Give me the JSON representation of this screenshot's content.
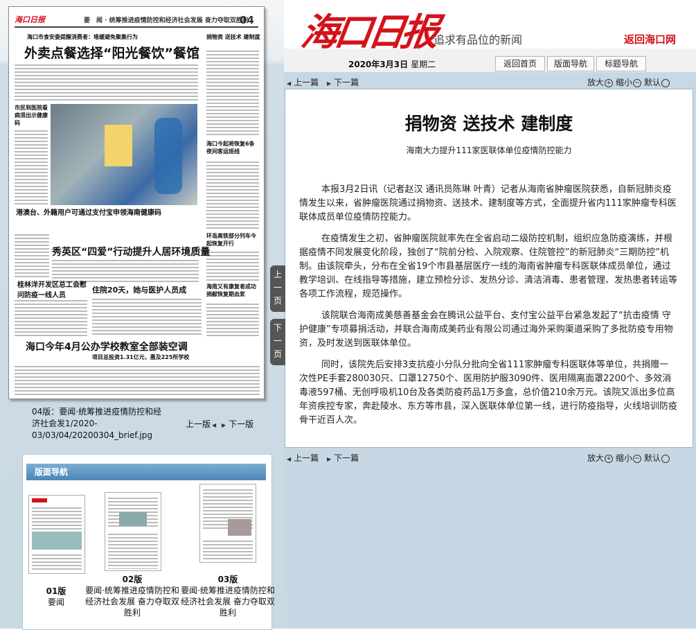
{
  "header": {
    "logo": "海口日报",
    "slogan": "追求有品位的新闻",
    "back_link": "返回海口网",
    "date": "2020年3月3日",
    "weekday": "星期二",
    "nav": [
      "返回首页",
      "版面导航",
      "标题导航"
    ]
  },
  "pager": {
    "prev": "上一篇",
    "next": "下一篇",
    "zoom_in": "放大",
    "zoom_out": "缩小",
    "default": "默认",
    "zoom_in_icon": "+",
    "zoom_out_icon": "−"
  },
  "article": {
    "title": "捐物资 送技术 建制度",
    "subtitle": "海南大力提升111家医联体单位疫情防控能力",
    "paragraphs": [
      "本报3月2日讯（记者赵汉 通讯员陈琳 叶青）记者从海南省肿瘤医院获悉，自新冠肺炎疫情发生以来，省肿瘤医院通过捐物资、送技术、建制度等方式，全面提升省内111家肿瘤专科医联体成员单位疫情防控能力。",
      "在疫情发生之初，省肿瘤医院就率先在全省启动二级防控机制，组织应急防疫演练，并根据疫情不同发展变化阶段，独创了“院前分检、入院观察、住院管控”的新冠肺炎“三期防控”机制。由该院牵头，分布在全省19个市县基层医疗一线的海南省肿瘤专科医联体成员单位，通过教学培训、在线指导等措施，建立预检分诊、发热分诊、清洁消毒、患者管理、发热患者转运等各项工作流程，规范操作。",
      "该院联合海南成美慈善基金会在腾讯公益平台、支付宝公益平台紧急发起了“抗击疫情 守护健康”专项募捐活动，并联合海南成美药业有限公司通过海外采购渠道采购了多批防疫专用物资，及时发送到医联体单位。",
      "同时，该院先后安排3支抗疫小分队分批向全省111家肿瘤专科医联体等单位，共捐赠一次性PE手套280030只、口罩12750个、医用防护服3090件、医用隔离面罩2200个、多效消毒液597桶、无创呼吸机10台及各类防疫药品1万多盒，总价值210余万元。该院又派出多位高年资疾控专家，奔赴陵水、东方等市县，深入医联体单位第一线，进行防疫指导，火线培训防疫骨干近百人次。"
    ]
  },
  "paper": {
    "masthead": "海口日报",
    "section_line": "要　闻 · 统筹推进疫情防控和经济社会发展 奋力夺取双胜利",
    "page_no": "04",
    "kicker": "海口市食安委提醒消费者：堆缓避免聚集行为",
    "headline": "外卖点餐选择“阳光餐饮”餐馆",
    "side_head1": "捐物资 送技术 建制度",
    "side_head2": "海口今起将恢复6条夜间客运班线",
    "side_head3": "环岛高铁部分列车今起恢复开行",
    "side_head4": "海南又有康复者成功捐献恢复期血浆",
    "left_head1": "市民到医院看病须出示健康码",
    "left_head2": "港澳台、外籍用户可通过支付宝申领海南健康码",
    "mid_head1": "秀英区“四爱”行动提升人居环境质量",
    "mid_head2": "桂林洋开发区总工会慰问防疫一线人员",
    "mid_head3": "住院20天，她与医护人员成为“亲人”",
    "bottom_head": "海口今年4月公办学校教室全部装空调",
    "bottom_sub": "项目总投资1.31亿元，惠及225所学校"
  },
  "side_tabs": {
    "prev": "上一页",
    "next": "下一页"
  },
  "caption": {
    "label": "04版：要闻·统筹推进疫情防控和经济社会发1/2020-03/03/04/20200304_brief.jpg",
    "prev_page": "上一版",
    "next_page": "下一版"
  },
  "layout_nav": {
    "header": "版面导航",
    "items": [
      {
        "no": "01版",
        "name": "要闻"
      },
      {
        "no": "02版",
        "name": "要闻·统筹推进疫情防控和经济社会发展 奋力夺取双胜利"
      },
      {
        "no": "03版",
        "name": "要闻·统筹推进疫情防控和经济社会发展 奋力夺取双胜利"
      }
    ]
  },
  "colors": {
    "brand_red": "#d4121a",
    "panel_blue": "#c7d8e4",
    "nav_header_blue": "#4b86b8"
  }
}
